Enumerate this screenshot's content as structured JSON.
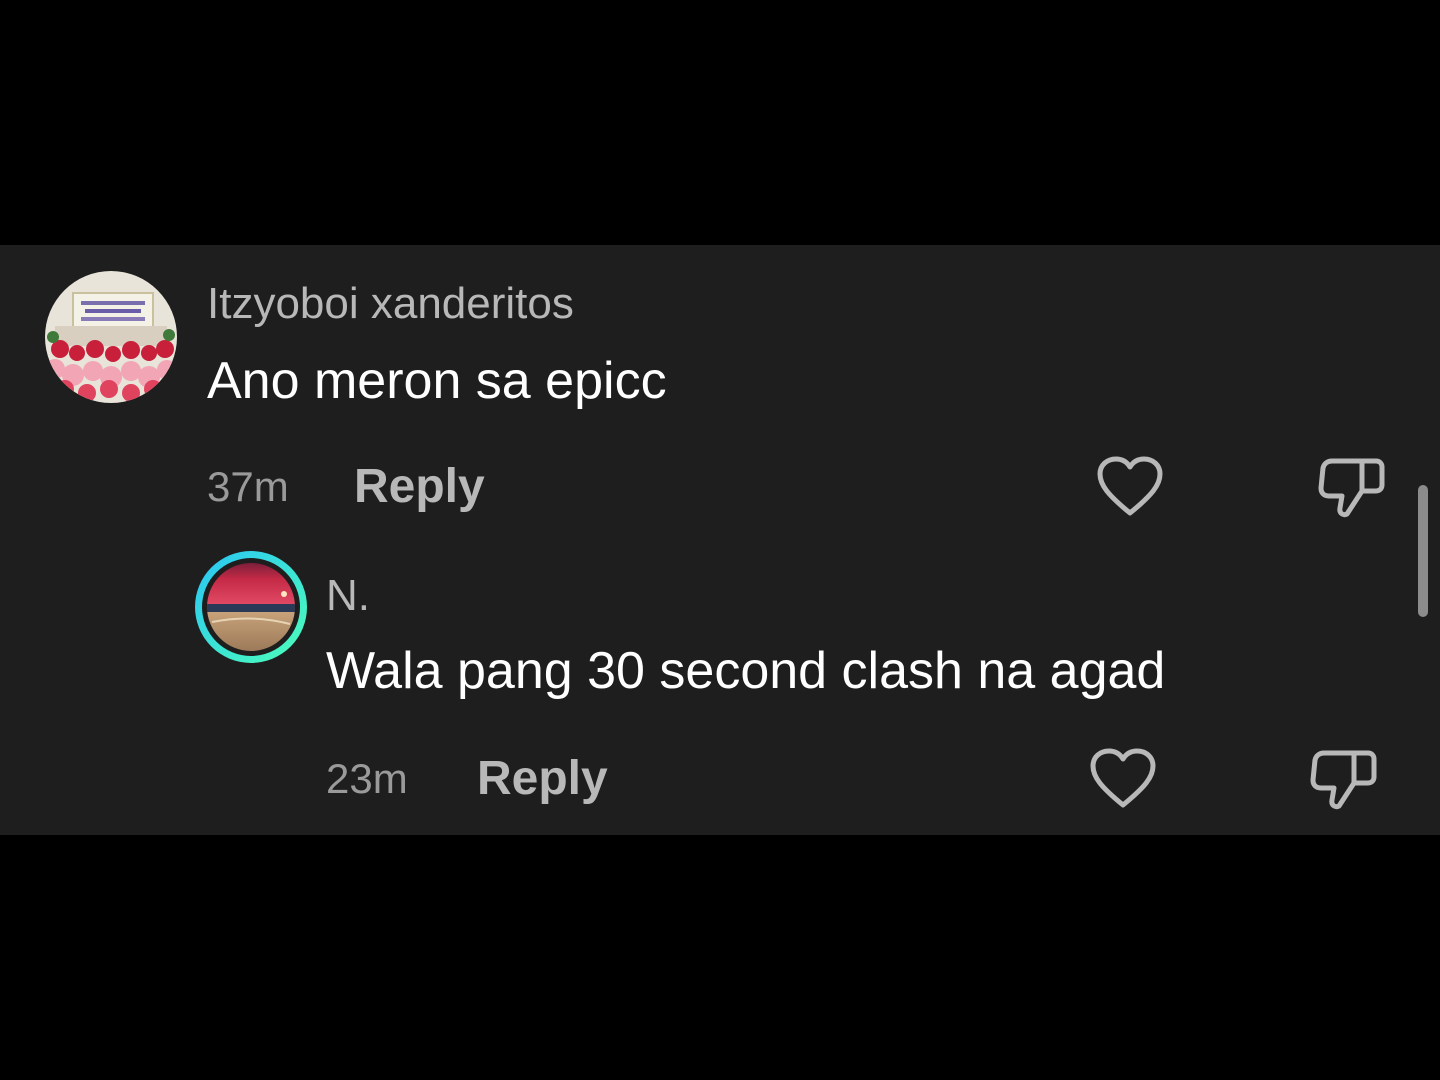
{
  "comments": [
    {
      "username": "Itzyoboi xanderitos",
      "text": "Ano meron sa epicc",
      "time": "37m",
      "reply_label": "Reply",
      "avatar": "group-photo-avatar",
      "icons": {
        "like": "heart-icon",
        "dislike": "thumbs-down-icon"
      }
    },
    {
      "username": "N.",
      "text": "Wala pang 30 second clash na agad",
      "time": "23m",
      "reply_label": "Reply",
      "avatar": "sunset-beach-avatar",
      "avatar_ring_colors": [
        "#29c5f6",
        "#4dffb8"
      ],
      "icons": {
        "like": "heart-icon",
        "dislike": "thumbs-down-icon"
      }
    }
  ],
  "colors": {
    "panel_bg": "#1e1e1e",
    "letterbox": "#000000",
    "username": "#b8b8b8",
    "text": "#ffffff",
    "time": "#9a9a9a"
  }
}
